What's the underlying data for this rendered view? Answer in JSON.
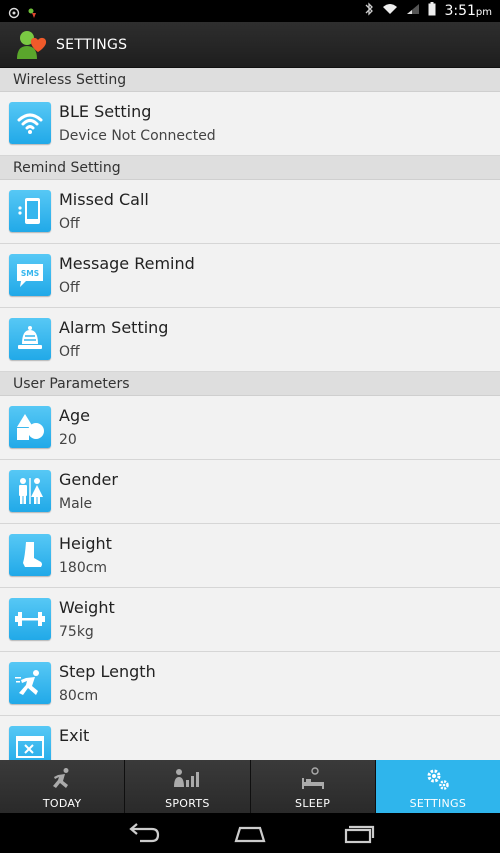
{
  "status_bar": {
    "time": "3:51",
    "time_suffix": "pm"
  },
  "header": {
    "title": "SETTINGS"
  },
  "sections": [
    {
      "title": "Wireless Setting",
      "items": [
        {
          "title": "BLE Setting",
          "value": "Device Not Connected",
          "icon": "wifi-icon"
        }
      ]
    },
    {
      "title": "Remind Setting",
      "items": [
        {
          "title": "Missed Call",
          "value": "Off",
          "icon": "phone-icon"
        },
        {
          "title": "Message Remind",
          "value": "Off",
          "icon": "sms-icon"
        },
        {
          "title": "Alarm Setting",
          "value": "Off",
          "icon": "bell-icon"
        }
      ]
    },
    {
      "title": "User Parameters",
      "items": [
        {
          "title": "Age",
          "value": "20",
          "icon": "shapes-icon"
        },
        {
          "title": "Gender",
          "value": "Male",
          "icon": "gender-icon"
        },
        {
          "title": "Height",
          "value": "180cm",
          "icon": "boot-icon"
        },
        {
          "title": "Weight",
          "value": "75kg",
          "icon": "dumbbell-icon"
        },
        {
          "title": "Step Length",
          "value": "80cm",
          "icon": "runner-icon"
        },
        {
          "title": "Exit",
          "value": "",
          "icon": "exit-icon"
        }
      ]
    }
  ],
  "sms_icon_text": "SMS",
  "tabs": [
    {
      "label": "TODAY",
      "icon": "runner-icon",
      "active": false
    },
    {
      "label": "SPORTS",
      "icon": "stats-icon",
      "active": false
    },
    {
      "label": "SLEEP",
      "icon": "bed-icon",
      "active": false
    },
    {
      "label": "SETTINGS",
      "icon": "gears-icon",
      "active": true
    }
  ],
  "colors": {
    "accent": "#2fb5ec",
    "tile": "#35b6ee",
    "section_bg": "#dedede",
    "row_bg": "#f2f2f2"
  }
}
